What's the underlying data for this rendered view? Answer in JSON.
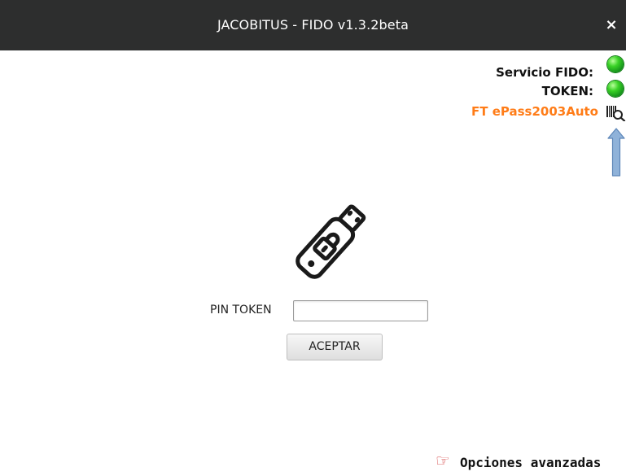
{
  "window": {
    "title": "JACOBITUS - FIDO v1.3.2beta",
    "close_symbol": "×"
  },
  "status": {
    "fido_service_label": "Servicio FIDO:",
    "fido_service_state": "green",
    "token_label": "TOKEN:",
    "token_state": "green",
    "token_device_name": "FT ePass2003Auto",
    "token_device_color": "#ff7c17",
    "device_icon": "barcode-search-icon",
    "arrow_icon": "arrow-up-icon"
  },
  "login": {
    "image_icon": "usb-lock-icon",
    "pin_label": "PIN TOKEN",
    "pin_value": "",
    "accept_label": "ACEPTAR"
  },
  "advanced": {
    "icon": "pointing-hand-icon",
    "label": "Opciones avanzadas"
  },
  "colors": {
    "titlebar_bg": "#2d2e2e",
    "led_green": "#3ad226",
    "arrow_blue": "#8fb2d9"
  }
}
